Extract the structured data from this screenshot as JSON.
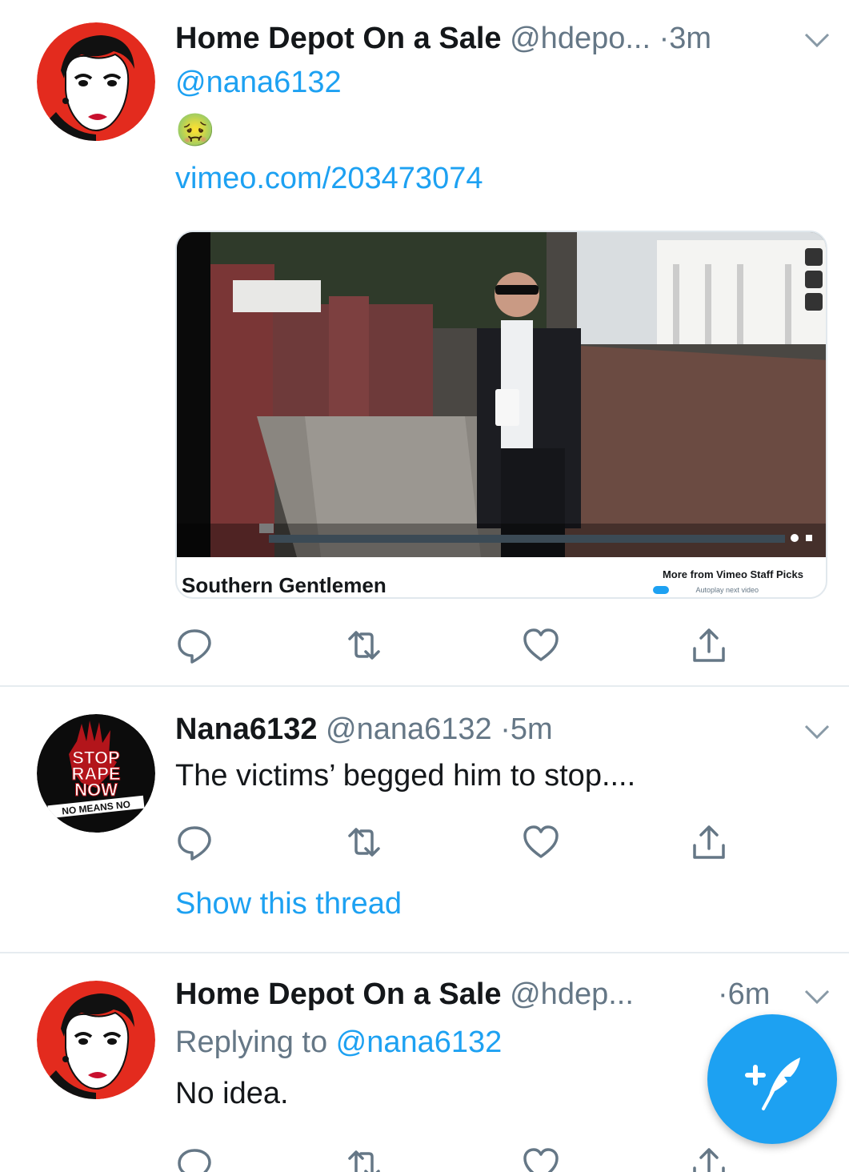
{
  "tweets": [
    {
      "name": "Home Depot On a Sale",
      "handle": "@hdepo...",
      "time": "3m",
      "mention": "@nana6132",
      "emoji": "🤢",
      "link": "vimeo.com/203473074",
      "card": {
        "title": "Southern Gentlemen",
        "more": "More from Vimeo Staff Picks",
        "autoplay": "Autoplay next video"
      }
    },
    {
      "name": "Nana6132",
      "handle": "@nana6132",
      "time": "5m",
      "text": "The victims’ begged him to stop....",
      "show_thread": "Show this thread",
      "avatar_text": {
        "top": "STOP",
        "middle": "RAPE",
        "bottom": "NOW",
        "banner": "NO MEANS NO"
      }
    },
    {
      "name": "Home Depot On a Sale",
      "handle": "@hdep...",
      "time": "6m",
      "replying_prefix": "Replying to ",
      "replying_handle": "@nana6132",
      "text": "No idea."
    }
  ],
  "colors": {
    "accent": "#1da1f2",
    "text": "#14171a",
    "muted": "#657786",
    "divider": "#e6ecf0"
  },
  "icons": [
    "reply-icon",
    "retweet-icon",
    "like-icon",
    "share-icon",
    "chevron-down-icon",
    "compose-icon",
    "play-icon"
  ]
}
